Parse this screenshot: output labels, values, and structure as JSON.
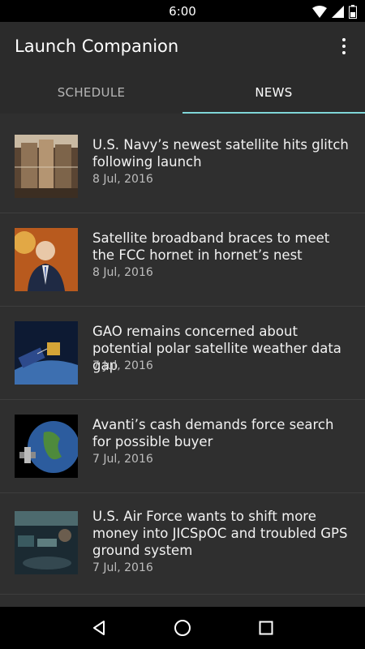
{
  "status_bar": {
    "time": "6:00",
    "icons": [
      "wifi-icon",
      "signal-icon",
      "battery-icon"
    ]
  },
  "app_bar": {
    "title": "Launch Companion",
    "menu_icon": "more-vert-icon"
  },
  "tabs": [
    {
      "label": "SCHEDULE",
      "active": false
    },
    {
      "label": "NEWS",
      "active": true
    }
  ],
  "colors": {
    "app_bar": "#2b2b2b",
    "list_bg": "#2f2f2f",
    "tab_indicator": "#7fd6d8"
  },
  "news": [
    {
      "title": "U.S. Navy’s newest satellite hits glitch following launch",
      "date": "8 Jul, 2016",
      "thumb": "satellite-factory-image"
    },
    {
      "title": "Satellite broadband braces to meet the FCC hornet in hornet’s nest",
      "date": "8 Jul, 2016",
      "thumb": "fcc-chairman-image"
    },
    {
      "title": "GAO remains concerned about potential polar satellite weather data gap",
      "date": "7 Jul, 2016",
      "thumb": "polar-satellite-image"
    },
    {
      "title": "Avanti’s cash demands force search for possible buyer",
      "date": "7 Jul, 2016",
      "thumb": "earth-satellite-image"
    },
    {
      "title": "U.S. Air Force wants to shift more money into  JICSpOC and troubled GPS ground system",
      "date": "7 Jul, 2016",
      "thumb": "control-room-image"
    }
  ],
  "nav_bar": [
    "back-icon",
    "home-icon",
    "recents-icon"
  ]
}
